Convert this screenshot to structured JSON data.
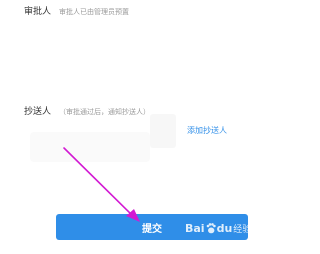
{
  "approver": {
    "label": "审批人",
    "hint": "审批人已由管理员预置"
  },
  "cc": {
    "label": "抄送人",
    "hint": "（审批通过后，通知抄送人）",
    "add_link": "添加抄送人"
  },
  "submit": {
    "label": "提交"
  },
  "watermark": {
    "brand_left": "Bai",
    "brand_right": "du",
    "text": "经验"
  },
  "colors": {
    "accent": "#2f8ee8",
    "annotation_arrow": "#d21ad2"
  },
  "icons": {
    "watermark_paw": "baidu-paw-icon",
    "annotation": "arrow-annotation-icon"
  }
}
